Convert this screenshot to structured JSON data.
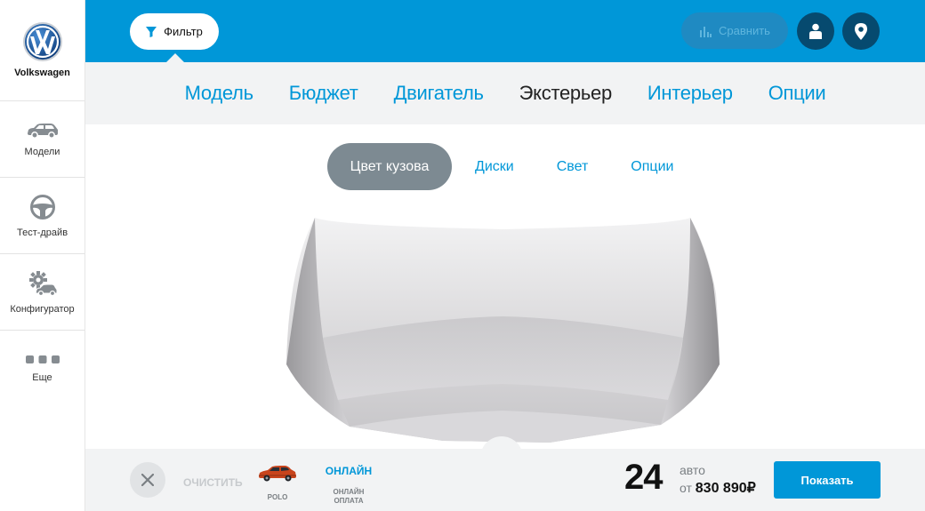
{
  "brand": {
    "name": "Volkswagen",
    "logo_icon": "vw-logo-icon"
  },
  "sidebar": {
    "items": [
      {
        "label": "Модели",
        "icon": "car-icon"
      },
      {
        "label": "Тест-драйв",
        "icon": "steering-wheel-icon"
      },
      {
        "label": "Конфигуратор",
        "icon": "configurator-gear-car-icon"
      },
      {
        "label": "Еще",
        "icon": "more-dots-icon"
      }
    ]
  },
  "topbar": {
    "filter_label": "Фильтр",
    "compare_label": "Сравнить",
    "user_icon": "user-icon",
    "location_icon": "location-pin-icon"
  },
  "nav": {
    "tabs": [
      {
        "label": "Модель",
        "active": false
      },
      {
        "label": "Бюджет",
        "active": false
      },
      {
        "label": "Двигатель",
        "active": false
      },
      {
        "label": "Экстерьер",
        "active": true
      },
      {
        "label": "Интерьер",
        "active": false
      },
      {
        "label": "Опции",
        "active": false
      }
    ]
  },
  "subtabs": [
    {
      "label": "Цвет кузова",
      "active": true
    },
    {
      "label": "Диски",
      "active": false
    },
    {
      "label": "Свет",
      "active": false
    },
    {
      "label": "Опции",
      "active": false
    }
  ],
  "bottom": {
    "clear_label": "ОЧИСТИТЬ",
    "model_chip_label": "POLO",
    "online_title": "ОНЛАЙН",
    "online_caption": "ОНЛАЙН ОПЛАТА",
    "count": "24",
    "count_unit": "авто",
    "price_prefix": "от",
    "price_value": "830 890₽",
    "show_label": "Показать"
  },
  "colors": {
    "accent": "#0097d8",
    "topbar": "#0097d8",
    "nav_bg": "#f2f3f4",
    "active_subtab": "#7d8a92",
    "dark_button": "#064a6f"
  }
}
